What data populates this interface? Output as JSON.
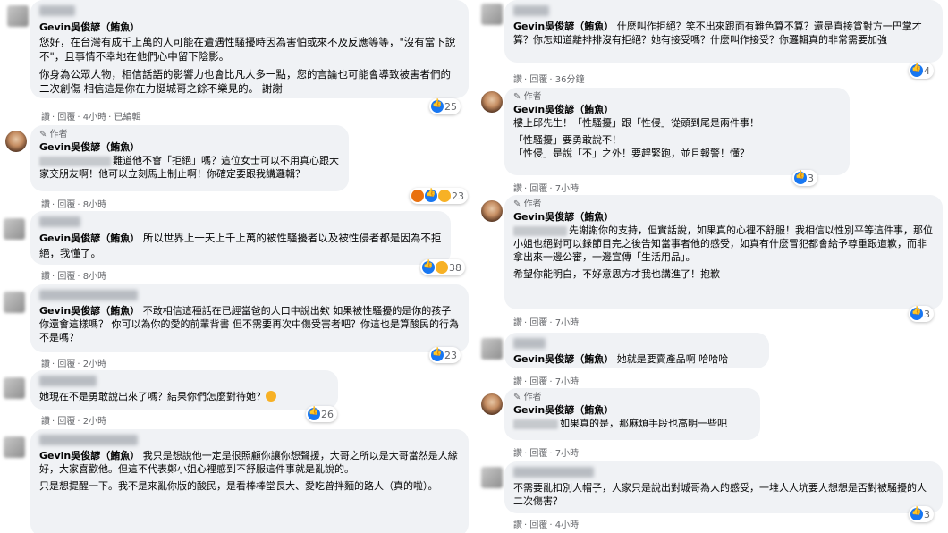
{
  "comments_left": [
    {
      "name": "Gevin吳俊諺（鮪魚）",
      "text": "您好，在台灣有成千上萬的人可能在遭遇性騷擾時因為害怕或來不及反應等等，\"沒有當下說不\"，且事情不幸地在他們心中留下陰影。",
      "text2": "你身為公眾人物，相信話語的影響力也會比凡人多一點，您的言論也可能會導致被害者們的二次創傷 相信這是你在力挺城哥之餘不樂見的。 謝謝",
      "meta": [
        "讚",
        "回覆",
        "4小時",
        "已編輯"
      ],
      "count": "25"
    },
    {
      "author": "作者",
      "name": "Gevin吳俊諺（鮪魚）",
      "text": "難道他不會「拒絕」嗎？這位女士可以不用真心跟大家交朋友啊！他可以立刻馬上制止啊！你確定要跟我講邏輯？",
      "meta": [
        "讚",
        "回覆",
        "8小時"
      ],
      "count": "23"
    },
    {
      "name": "Gevin吳俊諺（鮪魚）",
      "text": "所以世界上一天上千上萬的被性騷擾者以及被性侵者都是因為不拒絕，我懂了。",
      "meta": [
        "讚",
        "回覆",
        "8小時"
      ],
      "count": "38"
    },
    {
      "name": "Gevin吳俊諺（鮪魚）",
      "text": "不敢相信這種話在已經當爸的人口中說出欸 如果被性騷擾的是你的孩子你還會這樣嗎？ 你可以為你的愛的前輩背書 但不需要再次中傷受害者吧？你這也是算酸民的行為不是嗎？",
      "meta": [
        "讚",
        "回覆",
        "2小時"
      ],
      "count": "23"
    },
    {
      "text": "她現在不是勇敢說出來了嗎？結果你們怎麼對待她？",
      "meta": [
        "讚",
        "回覆",
        "2小時"
      ],
      "count": "26"
    },
    {
      "name": "Gevin吳俊諺（鮪魚）",
      "text": "我只是想說他一定是很照顧你讓你想聲援，大哥之所以是大哥當然是人緣好，大家喜歡他。但這不代表鄭小姐心裡感到不舒服這件事就是亂說的。",
      "text2": "只是想提醒一下。我不是來亂你版的酸民，是看棒棒堂長大、愛吃曾拌麵的路人（真的啦）。"
    }
  ],
  "comments_right": [
    {
      "name": "Gevin吳俊諺（鮪魚）",
      "text": "什麼叫作拒絕？笑不出來跟面有難色算不算？還是直接賞對方一巴掌才算？你怎知道離排排沒有拒絕？她有接受嗎？什麼叫作接受？你邏輯真的非常需要加強",
      "meta": [
        "讚",
        "回覆",
        "36分鐘"
      ],
      "count": "4"
    },
    {
      "author": "作者",
      "name": "Gevin吳俊諺（鮪魚）",
      "text": "樓上邱先生！「性騷擾」跟「性侵」從頭到尾是兩件事！",
      "text2": "「性騷擾」要勇敢說不！\n「性侵」是說「不」之外！要趕緊跑，並且報警！懂？",
      "meta": [
        "讚",
        "回覆",
        "7小時"
      ],
      "count": "3"
    },
    {
      "author": "作者",
      "name": "Gevin吳俊諺（鮪魚）",
      "text": "先謝謝你的支持，但實話說，如果真的心裡不舒服！我相信以性別平等這件事，那位小姐也絕對可以錄節目完之後告知當事者他的感受，如真有什麼冒犯都會給予尊重跟道歉，而非拿出來一邊公審，一邊宣傳「生活用品」。",
      "text2": "希望你能明白，不好意思方才我也講進了！抱歉",
      "meta": [
        "讚",
        "回覆",
        "7小時"
      ],
      "count": "3"
    },
    {
      "name": "Gevin吳俊諺（鮪魚）",
      "text": "她就是要賣產品啊 哈哈哈",
      "meta": [
        "讚",
        "回覆",
        "7小時"
      ]
    },
    {
      "author": "作者",
      "name": "Gevin吳俊諺（鮪魚）",
      "text": "如果真的是，那麻煩手段也高明一些吧",
      "meta": [
        "讚",
        "回覆",
        "7小時"
      ]
    },
    {
      "text": "不需要亂扣別人帽子，人家只是說出對城哥為人的感受，一堆人人坑要人想想是否對被騷擾的人二次傷害？",
      "meta": [
        "讚",
        "回覆",
        "4小時"
      ],
      "count": "3"
    }
  ]
}
